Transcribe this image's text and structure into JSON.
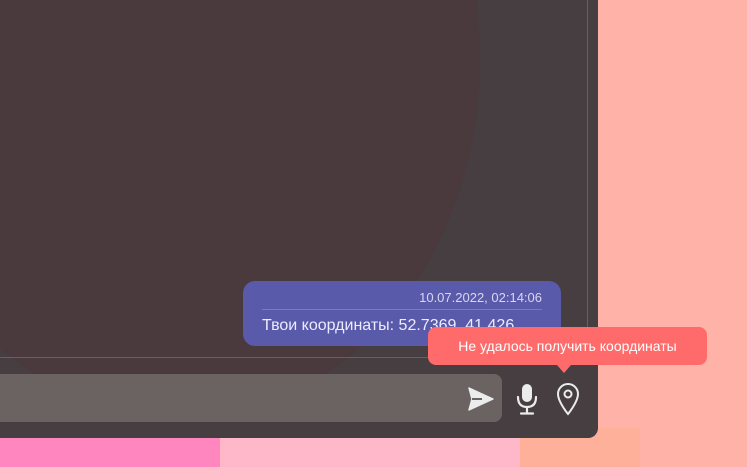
{
  "message": {
    "timestamp": "10.07.2022, 02:14:06",
    "text": "Твои координаты: 52.7369, 41.426"
  },
  "tooltip": {
    "text": "Не удалось получить координаты"
  },
  "icons": {
    "send": "send-icon",
    "mic": "microphone-icon",
    "location": "location-pin-icon"
  },
  "colors": {
    "panel": "#463e41",
    "bubble": "#5a5aaa",
    "tooltip": "#ff6b6b",
    "background": "#ffb2a8"
  }
}
